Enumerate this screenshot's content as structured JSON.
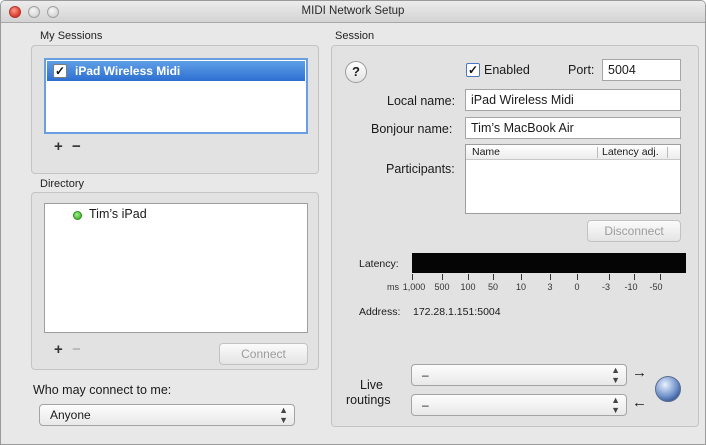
{
  "window": {
    "title": "MIDI Network Setup"
  },
  "my_sessions": {
    "label": "My Sessions",
    "items": [
      {
        "name": "iPad Wireless Midi",
        "checked": true,
        "selected": true
      }
    ],
    "add": "+",
    "remove": "−"
  },
  "directory": {
    "label": "Directory",
    "items": [
      {
        "name": "Tim’s iPad",
        "status": "online",
        "status_color": "#2ea61c"
      }
    ],
    "add": "+",
    "remove": "−",
    "connect_label": "Connect"
  },
  "who_may_connect": {
    "label": "Who may connect to me:",
    "value": "Anyone"
  },
  "session": {
    "label": "Session",
    "help": "?",
    "enabled_label": "Enabled",
    "enabled": true,
    "port_label": "Port:",
    "port_value": "5004",
    "local_name_label": "Local name:",
    "local_name_value": "iPad Wireless Midi",
    "bonjour_name_label": "Bonjour name:",
    "bonjour_name_value": "Tim’s MacBook Air",
    "participants_label": "Participants:",
    "participants_columns": [
      "Name",
      "Latency adj."
    ],
    "disconnect_label": "Disconnect",
    "latency_label": "Latency:",
    "latency_unit": "ms",
    "latency_ticks": [
      "1,000",
      "500",
      "100",
      "50",
      "10",
      "3",
      "0",
      "-3",
      "-10",
      "-50"
    ],
    "address_label": "Address:",
    "address_value": "172.28.1.151:5004",
    "live_routings_label_1": "Live",
    "live_routings_label_2": "routings",
    "routing_in_value": "–",
    "routing_out_value": "–",
    "arrow_out": "→",
    "arrow_in": "←"
  },
  "icons": {
    "globe": "network-globe-icon",
    "help": "help-icon",
    "status": "status-dot-icon"
  }
}
